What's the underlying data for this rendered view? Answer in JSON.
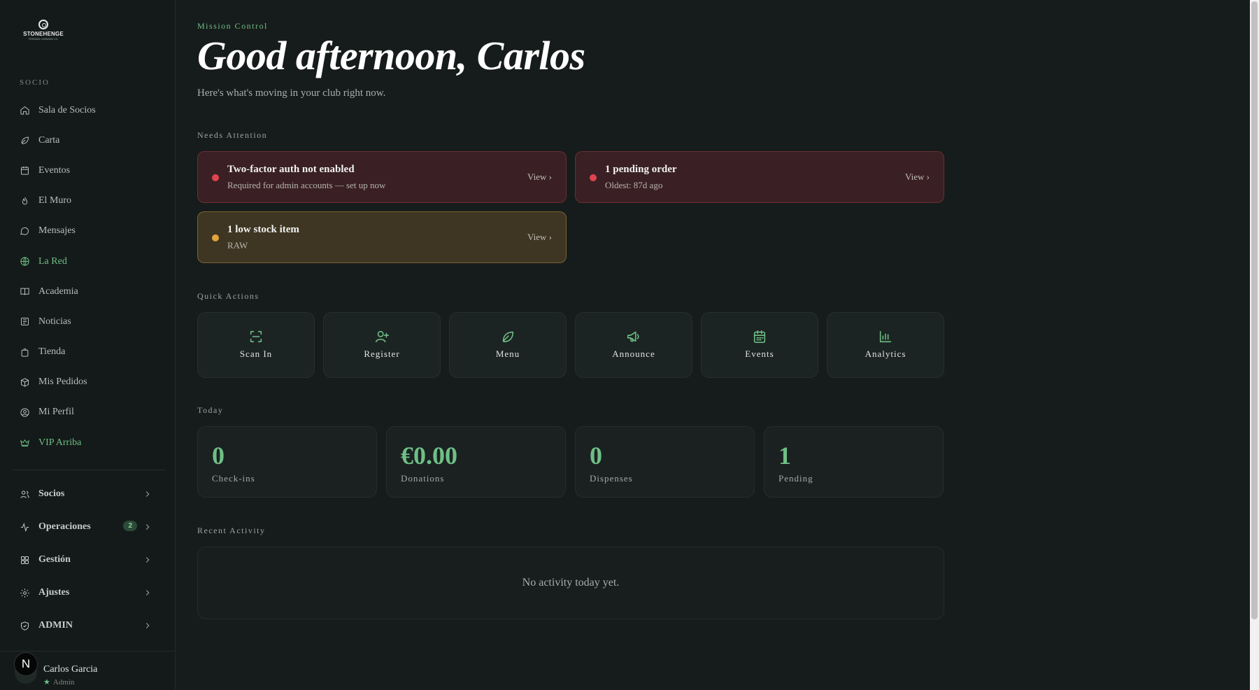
{
  "sidebar": {
    "logo": {
      "word": "STONEHENGE",
      "sub": "PREMIUM CANNABIS CO."
    },
    "section_label": "SOCIO",
    "items": [
      {
        "label": "Sala de Socios",
        "icon": "home-icon"
      },
      {
        "label": "Carta",
        "icon": "leaf-icon"
      },
      {
        "label": "Eventos",
        "icon": "calendar-icon"
      },
      {
        "label": "El Muro",
        "icon": "flame-icon"
      },
      {
        "label": "Mensajes",
        "icon": "chat-icon"
      },
      {
        "label": "La Red",
        "icon": "globe-icon",
        "active": true
      },
      {
        "label": "Academia",
        "icon": "book-icon"
      },
      {
        "label": "Noticias",
        "icon": "newspaper-icon"
      },
      {
        "label": "Tienda",
        "icon": "shopping-bag-icon"
      },
      {
        "label": "Mis Pedidos",
        "icon": "package-icon"
      },
      {
        "label": "Mi Perfil",
        "icon": "user-circle-icon"
      },
      {
        "label": "VIP Arriba",
        "icon": "crown-icon",
        "active": true
      }
    ],
    "groups": [
      {
        "label": "Socios",
        "icon": "users-icon"
      },
      {
        "label": "Operaciones",
        "icon": "activity-icon",
        "badge": "2"
      },
      {
        "label": "Gestión",
        "icon": "grid-icon"
      },
      {
        "label": "Ajustes",
        "icon": "gear-icon"
      },
      {
        "label": "ADMIN",
        "icon": "shield-icon"
      }
    ],
    "user": {
      "avatar_letter": "N",
      "name": "Carlos Garcia",
      "role": "Admin"
    }
  },
  "main": {
    "eyebrow": "Mission Control",
    "title": "Good afternoon, Carlos",
    "subtitle": "Here's what's moving in your club right now.",
    "needs_attention_label": "Needs Attention",
    "alerts": [
      {
        "title": "Two-factor auth not enabled",
        "subtitle": "Required for admin accounts — set up now",
        "action": "View ›",
        "severity": "red"
      },
      {
        "title": "1 pending order",
        "subtitle": "Oldest: 87d ago",
        "action": "View ›",
        "severity": "red"
      },
      {
        "title": "1 low stock item",
        "subtitle": "RAW",
        "action": "View ›",
        "severity": "amber"
      }
    ],
    "quick_actions_label": "Quick Actions",
    "quick_actions": [
      {
        "label": "Scan In",
        "icon": "scan-icon"
      },
      {
        "label": "Register",
        "icon": "user-plus-icon"
      },
      {
        "label": "Menu",
        "icon": "leaf-icon"
      },
      {
        "label": "Announce",
        "icon": "megaphone-icon"
      },
      {
        "label": "Events",
        "icon": "calendar-icon"
      },
      {
        "label": "Analytics",
        "icon": "bar-chart-icon"
      }
    ],
    "today_label": "Today",
    "stats": [
      {
        "value": "0",
        "label": "Check-ins"
      },
      {
        "value": "€0.00",
        "label": "Donations"
      },
      {
        "value": "0",
        "label": "Dispenses"
      },
      {
        "value": "1",
        "label": "Pending"
      }
    ],
    "recent_activity_label": "Recent Activity",
    "recent_activity_empty": "No activity today yet."
  },
  "colors": {
    "accent": "#6fbf86",
    "background": "#161c1b",
    "alert_red": "#e0444e",
    "alert_amber": "#e4a43a"
  }
}
